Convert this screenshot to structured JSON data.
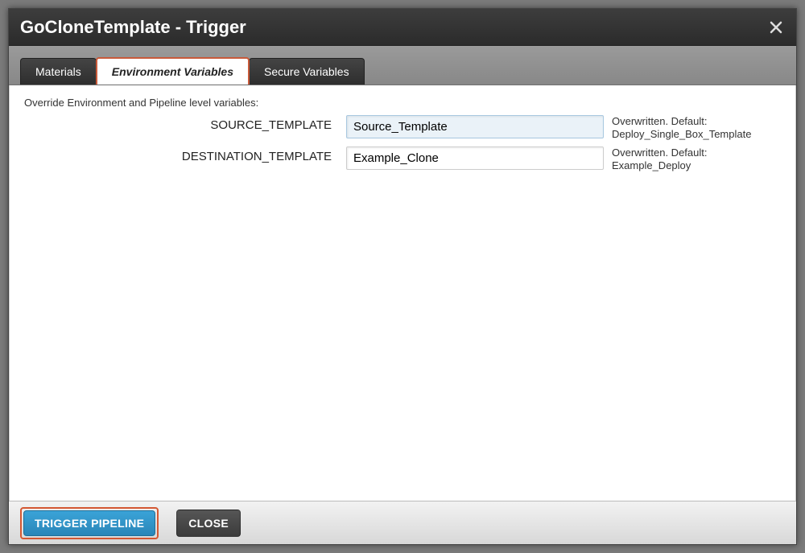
{
  "dialog": {
    "title": "GoCloneTemplate - Trigger"
  },
  "tabs": {
    "materials": "Materials",
    "env_vars": "Environment Variables",
    "secure_vars": "Secure Variables"
  },
  "content": {
    "instruction": "Override Environment and Pipeline level variables:"
  },
  "variables": [
    {
      "label": "SOURCE_TEMPLATE",
      "value": "Source_Template",
      "note": "Overwritten. Default: Deploy_Single_Box_Template",
      "focused": true
    },
    {
      "label": "DESTINATION_TEMPLATE",
      "value": "Example_Clone",
      "note": "Overwritten. Default: Example_Deploy",
      "focused": false
    }
  ],
  "footer": {
    "trigger": "TRIGGER PIPELINE",
    "close": "CLOSE"
  }
}
